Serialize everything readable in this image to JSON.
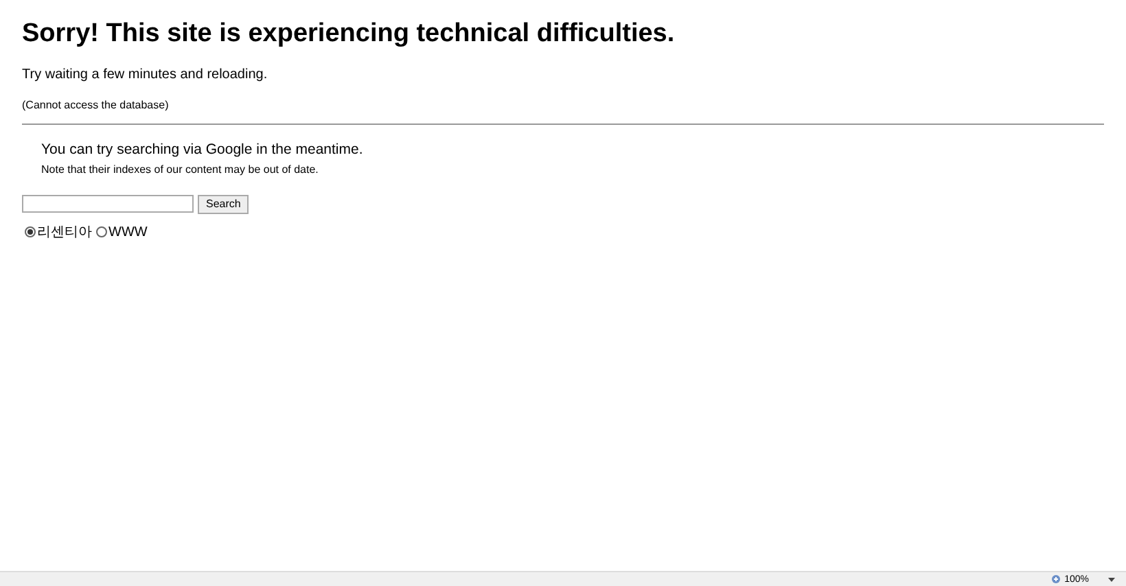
{
  "heading": "Sorry! This site is experiencing technical difficulties.",
  "message": "Try waiting a few minutes and reloading.",
  "error": "(Cannot access the database)",
  "search_note": {
    "title": "You can try searching via Google in the meantime.",
    "note": "Note that their indexes of our content may be out of date."
  },
  "search": {
    "button": "Search"
  },
  "scopes": [
    {
      "label": "리센티아",
      "selected": true
    },
    {
      "label": "WWW",
      "selected": false
    }
  ],
  "status_bar": {
    "zoom": "100%"
  }
}
